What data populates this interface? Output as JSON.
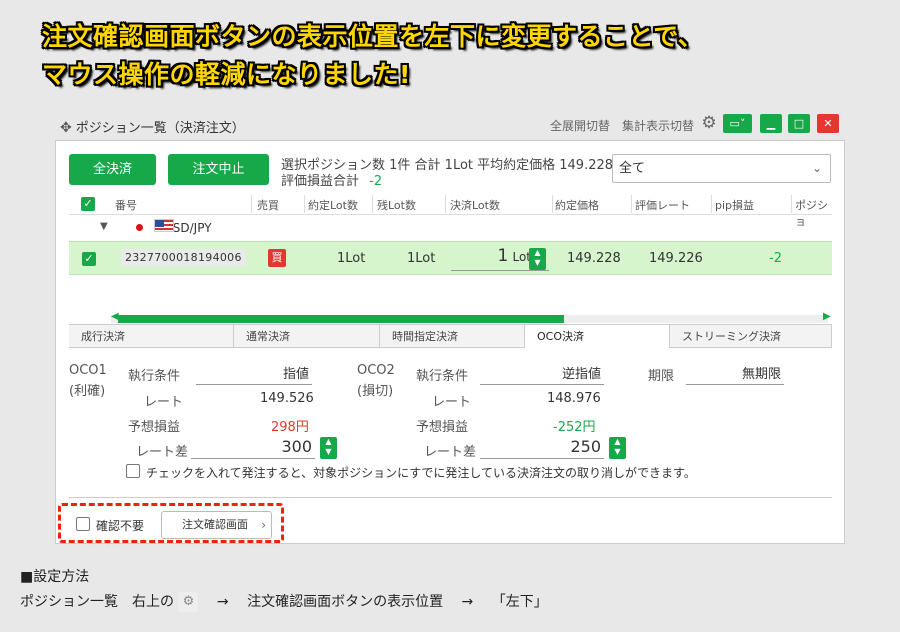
{
  "headline": {
    "line1": "注文確認画面ボタンの表示位置を左下に変更することで、",
    "line2": "マウス操作の軽減になりました!"
  },
  "window": {
    "title": "ポジション一覧（決済注文）",
    "toggle_expand": "全展開切替",
    "toggle_summary": "集計表示切替",
    "icons": [
      "move-icon",
      "gear-icon",
      "window-dropdown-icon",
      "minimize-icon",
      "maximize-icon",
      "close-icon"
    ],
    "colors": {
      "accent": "#17a84a",
      "close": "#e3372f"
    }
  },
  "actions": {
    "close_all": "全決済",
    "cancel_order": "注文中止"
  },
  "summary": {
    "line1": "選択ポジション数 1件  合計 1Lot 平均約定価格 149.228",
    "line2_label": "評価損益合計",
    "line2_value": "-2"
  },
  "filter": {
    "selected": "全て"
  },
  "table": {
    "headers": [
      "番号",
      "売買",
      "約定Lot数",
      "残Lot数",
      "決済Lot数",
      "約定価格",
      "評価レート",
      "pip損益",
      "ポジショ"
    ],
    "pair": "USD/JPY",
    "row": {
      "ticket": "2327700018194006",
      "side": "買",
      "filled_lots": "1Lot",
      "remaining_lots": "1Lot",
      "close_lot_value": "1",
      "close_lot_unit": "Lot",
      "price": "149.228",
      "rate": "149.226",
      "pip": "-2"
    }
  },
  "tabs": [
    "成行決済",
    "通常決済",
    "時間指定決済",
    "OCO決済",
    "ストリーミング決済"
  ],
  "tabs_active": "OCO決済",
  "oco1": {
    "title": "OCO1",
    "subtitle": "(利確)",
    "cond_label": "執行条件",
    "cond_value": "指値",
    "rate_label": "レート",
    "rate_value": "149.526",
    "pl_label": "予想損益",
    "pl_value": "298円",
    "diff_label": "レート差",
    "diff_value": "300"
  },
  "oco2": {
    "title": "OCO2",
    "subtitle": "(損切)",
    "cond_label": "執行条件",
    "cond_value": "逆指値",
    "rate_label": "レート",
    "rate_value": "148.976",
    "pl_label": "予想損益",
    "pl_value": "-252円",
    "diff_label": "レート差",
    "diff_value": "250"
  },
  "expiry": {
    "label": "期限",
    "value": "無期限"
  },
  "notice": "チェックを入れて発注すると、対象ポジションにすでに発注している決済注文の取り消しができます。",
  "footer": {
    "confirm_skip": "確認不要",
    "order_screen": "注文確認画面"
  },
  "setting": {
    "heading": "■設定方法",
    "part1": "ポジション一覧　右上の",
    "part2": "注文確認画面ボタンの表示位置",
    "part3": "「左下」",
    "arrow": "→"
  }
}
